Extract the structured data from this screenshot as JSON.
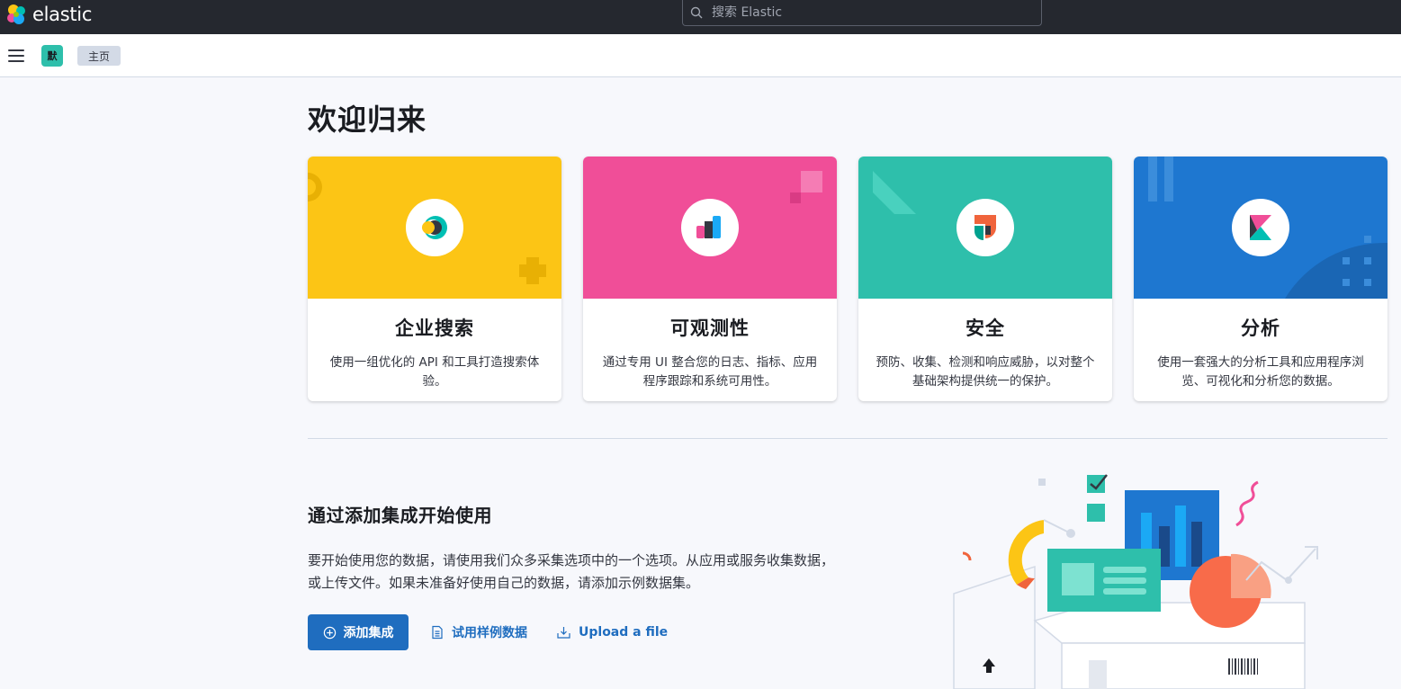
{
  "header": {
    "logo_text": "elastic",
    "search_placeholder": "搜索 Elastic"
  },
  "subbar": {
    "space_initial": "默",
    "breadcrumb": "主页"
  },
  "page": {
    "title": "欢迎归来"
  },
  "solutions": [
    {
      "title": "企业搜索",
      "description": "使用一组优化的 API 和工具打造搜索体验。",
      "color": "#fcc515"
    },
    {
      "title": "可观测性",
      "description": "通过专用 UI 整合您的日志、指标、应用程序跟踪和系统可用性。",
      "color": "#f04e98"
    },
    {
      "title": "安全",
      "description": "预防、收集、检测和响应威胁，以对整个基础架构提供统一的保护。",
      "color": "#2ebfab"
    },
    {
      "title": "分析",
      "description": "使用一套强大的分析工具和应用程序浏览、可视化和分析您的数据。",
      "color": "#1e77d0"
    }
  ],
  "integrations": {
    "title": "通过添加集成开始使用",
    "text": "要开始使用您的数据，请使用我们众多采集选项中的一个选项。从应用或服务收集数据，或上传文件。如果未准备好使用自己的数据，请添加示例数据集。",
    "add_button": "添加集成",
    "sample_link": "试用样例数据",
    "upload_link": "Upload a file"
  },
  "colors": {
    "header_bg": "#25282f",
    "accent": "#1f6dbf"
  }
}
